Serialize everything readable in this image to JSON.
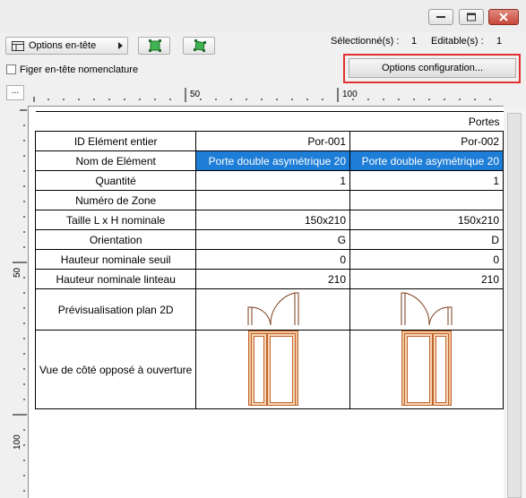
{
  "toolbar": {
    "options_header_label": "Options en-tête",
    "selected_label": "Sélectionné(s) :",
    "selected_count": "1",
    "editable_label": "Editable(s) :",
    "editable_count": "1",
    "freeze_header_label": "Figer en-tête nomenclature",
    "config_button_label": "Options configuration...",
    "corner_button_label": "..."
  },
  "ruler": {
    "h_labels": [
      "50",
      "100"
    ],
    "v_labels": [
      "50",
      "100"
    ]
  },
  "schedule": {
    "category_header": "Portes",
    "rows": [
      {
        "label": "ID Elément entier",
        "values": [
          "Por-001",
          "Por-002"
        ]
      },
      {
        "label": "Nom de Elément",
        "values": [
          "Porte double asymétrique 20",
          "Porte double asymétrique 20"
        ]
      },
      {
        "label": "Quantité",
        "values": [
          "1",
          "1"
        ]
      },
      {
        "label": "Numéro de Zone",
        "values": [
          "",
          ""
        ]
      },
      {
        "label": "Taille L x H nominale",
        "values": [
          "150x210",
          "150x210"
        ]
      },
      {
        "label": "Orientation",
        "values": [
          "G",
          "D"
        ]
      },
      {
        "label": "Hauteur nominale seuil",
        "values": [
          "0",
          "0"
        ]
      },
      {
        "label": "Hauteur nominale linteau",
        "values": [
          "210",
          "210"
        ]
      },
      {
        "label": "Prévisualisation plan 2D",
        "values": [
          "",
          ""
        ]
      },
      {
        "label": "Vue de côté opposé à ouverture",
        "values": [
          "",
          ""
        ]
      }
    ]
  },
  "colors": {
    "selection": "#1e7dd7",
    "highlight_border": "#e03030",
    "door_frame": "#c0622a",
    "door_fill": "#f3c79e"
  },
  "icons": {
    "options_header": "table-header-icon",
    "tool1": "select-element-icon",
    "tool2": "select-node-icon",
    "minimize": "minimize-icon",
    "maximize": "maximize-icon",
    "close": "close-icon"
  }
}
